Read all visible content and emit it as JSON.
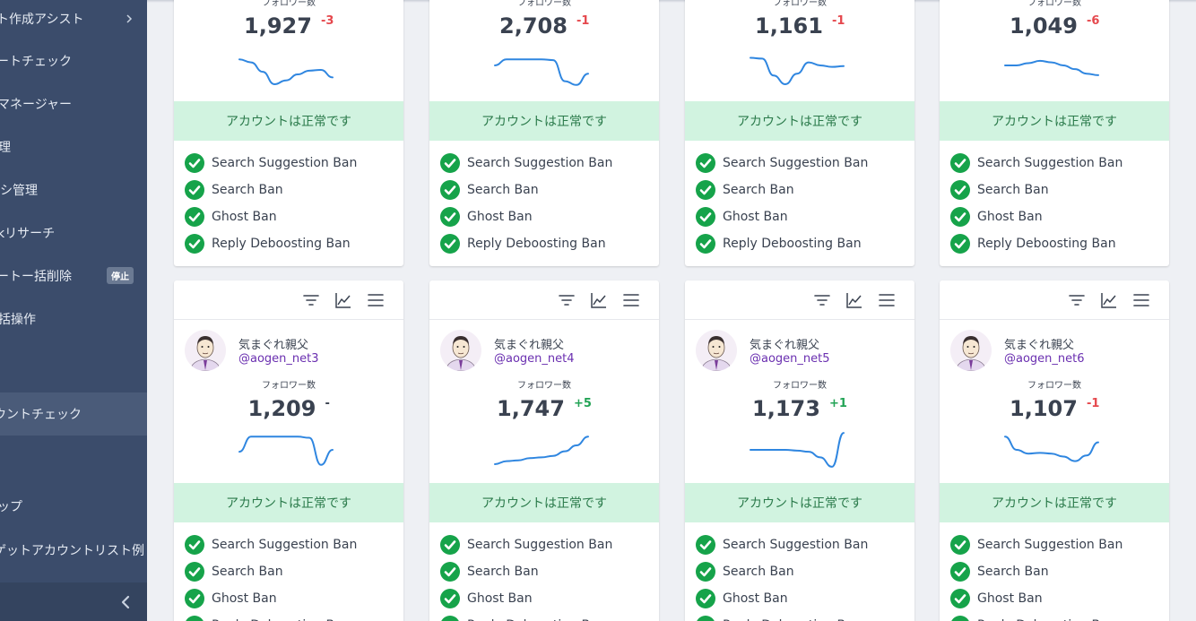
{
  "colors": {
    "sidebar_bg": "#3b4c6b",
    "status_bg": "#d1f3e0",
    "status_text": "#2a7a4a",
    "check_green": "#16a34a",
    "spark_blue": "#2f86e0",
    "delta_negative": "#e5484d",
    "delta_positive": "#22a355",
    "handle_purple": "#6a2fb0"
  },
  "sidebar": {
    "items": [
      {
        "label": "ート作成アシスト"
      },
      {
        "label": "ートチェック"
      },
      {
        "label": "マネージャー"
      },
      {
        "label": "理"
      },
      {
        "label": "キシ管理"
      },
      {
        "label": "kリサーチ"
      },
      {
        "label": "ートー括削除",
        "badge": "停止"
      },
      {
        "label": "括操作"
      },
      {
        "label": "ウントチェック",
        "active": true
      },
      {
        "label": "ップ"
      },
      {
        "label": "ゲットアカウントリスト例"
      }
    ]
  },
  "toolbar_icons": [
    "filter-icon",
    "chart-line-icon",
    "menu-icon"
  ],
  "cards_top": [
    {
      "follower_label": "フォロワー数",
      "follower_count": "1,927",
      "delta": "-3",
      "delta_sign": "negative",
      "spark": [
        0.78,
        0.7,
        0.45,
        0.12,
        0.22,
        0.38,
        0.48,
        0.5,
        0.3
      ],
      "status": "アカウントは正常です"
    },
    {
      "follower_label": "フォロワー数",
      "follower_count": "2,708",
      "delta": "-1",
      "delta_sign": "negative",
      "spark": [
        0.62,
        0.78,
        0.78,
        0.78,
        0.78,
        0.76,
        0.2,
        0.1,
        0.4
      ],
      "status": "アカウントは正常です"
    },
    {
      "follower_label": "フォロワー数",
      "follower_count": "1,161",
      "delta": "-1",
      "delta_sign": "negative",
      "spark": [
        0.82,
        0.8,
        0.35,
        0.12,
        0.4,
        0.7,
        0.62,
        0.58,
        0.6
      ],
      "status": "アカウントは正常です"
    },
    {
      "follower_label": "フォロワー数",
      "follower_count": "1,049",
      "delta": "-6",
      "delta_sign": "negative",
      "spark": [
        0.62,
        0.62,
        0.68,
        0.74,
        0.7,
        0.62,
        0.52,
        0.4,
        0.36
      ],
      "status": "アカウントは正常です"
    }
  ],
  "cards_bottom": [
    {
      "name": "気まぐれ親父",
      "handle": "@aogen_net3",
      "follower_label": "フォロワー数",
      "follower_count": "1,209",
      "delta": "-",
      "delta_sign": "neutral",
      "spark": [
        0.45,
        0.85,
        0.85,
        0.85,
        0.85,
        0.85,
        0.82,
        0.1,
        0.5
      ],
      "status": "アカウントは正常です"
    },
    {
      "name": "気まぐれ親父",
      "handle": "@aogen_net4",
      "follower_label": "フォロワー数",
      "follower_count": "1,747",
      "delta": "+5",
      "delta_sign": "positive",
      "spark": [
        0.12,
        0.2,
        0.22,
        0.28,
        0.3,
        0.34,
        0.46,
        0.62,
        0.85
      ],
      "status": "アカウントは正常です"
    },
    {
      "name": "気まぐれ親父",
      "handle": "@aogen_net5",
      "follower_label": "フォロワー数",
      "follower_count": "1,173",
      "delta": "+1",
      "delta_sign": "positive",
      "spark": [
        0.5,
        0.5,
        0.5,
        0.5,
        0.48,
        0.45,
        0.3,
        0.05,
        0.95
      ],
      "status": "アカウントは正常です"
    },
    {
      "name": "気まぐれ親父",
      "handle": "@aogen_net6",
      "follower_label": "フォロワー数",
      "follower_count": "1,107",
      "delta": "-1",
      "delta_sign": "negative",
      "spark": [
        0.85,
        0.5,
        0.4,
        0.42,
        0.4,
        0.32,
        0.2,
        0.35,
        0.7
      ],
      "status": "アカウントは正常です"
    }
  ],
  "ban_checks": [
    "Search Suggestion Ban",
    "Search Ban",
    "Ghost Ban",
    "Reply Deboosting Ban"
  ]
}
